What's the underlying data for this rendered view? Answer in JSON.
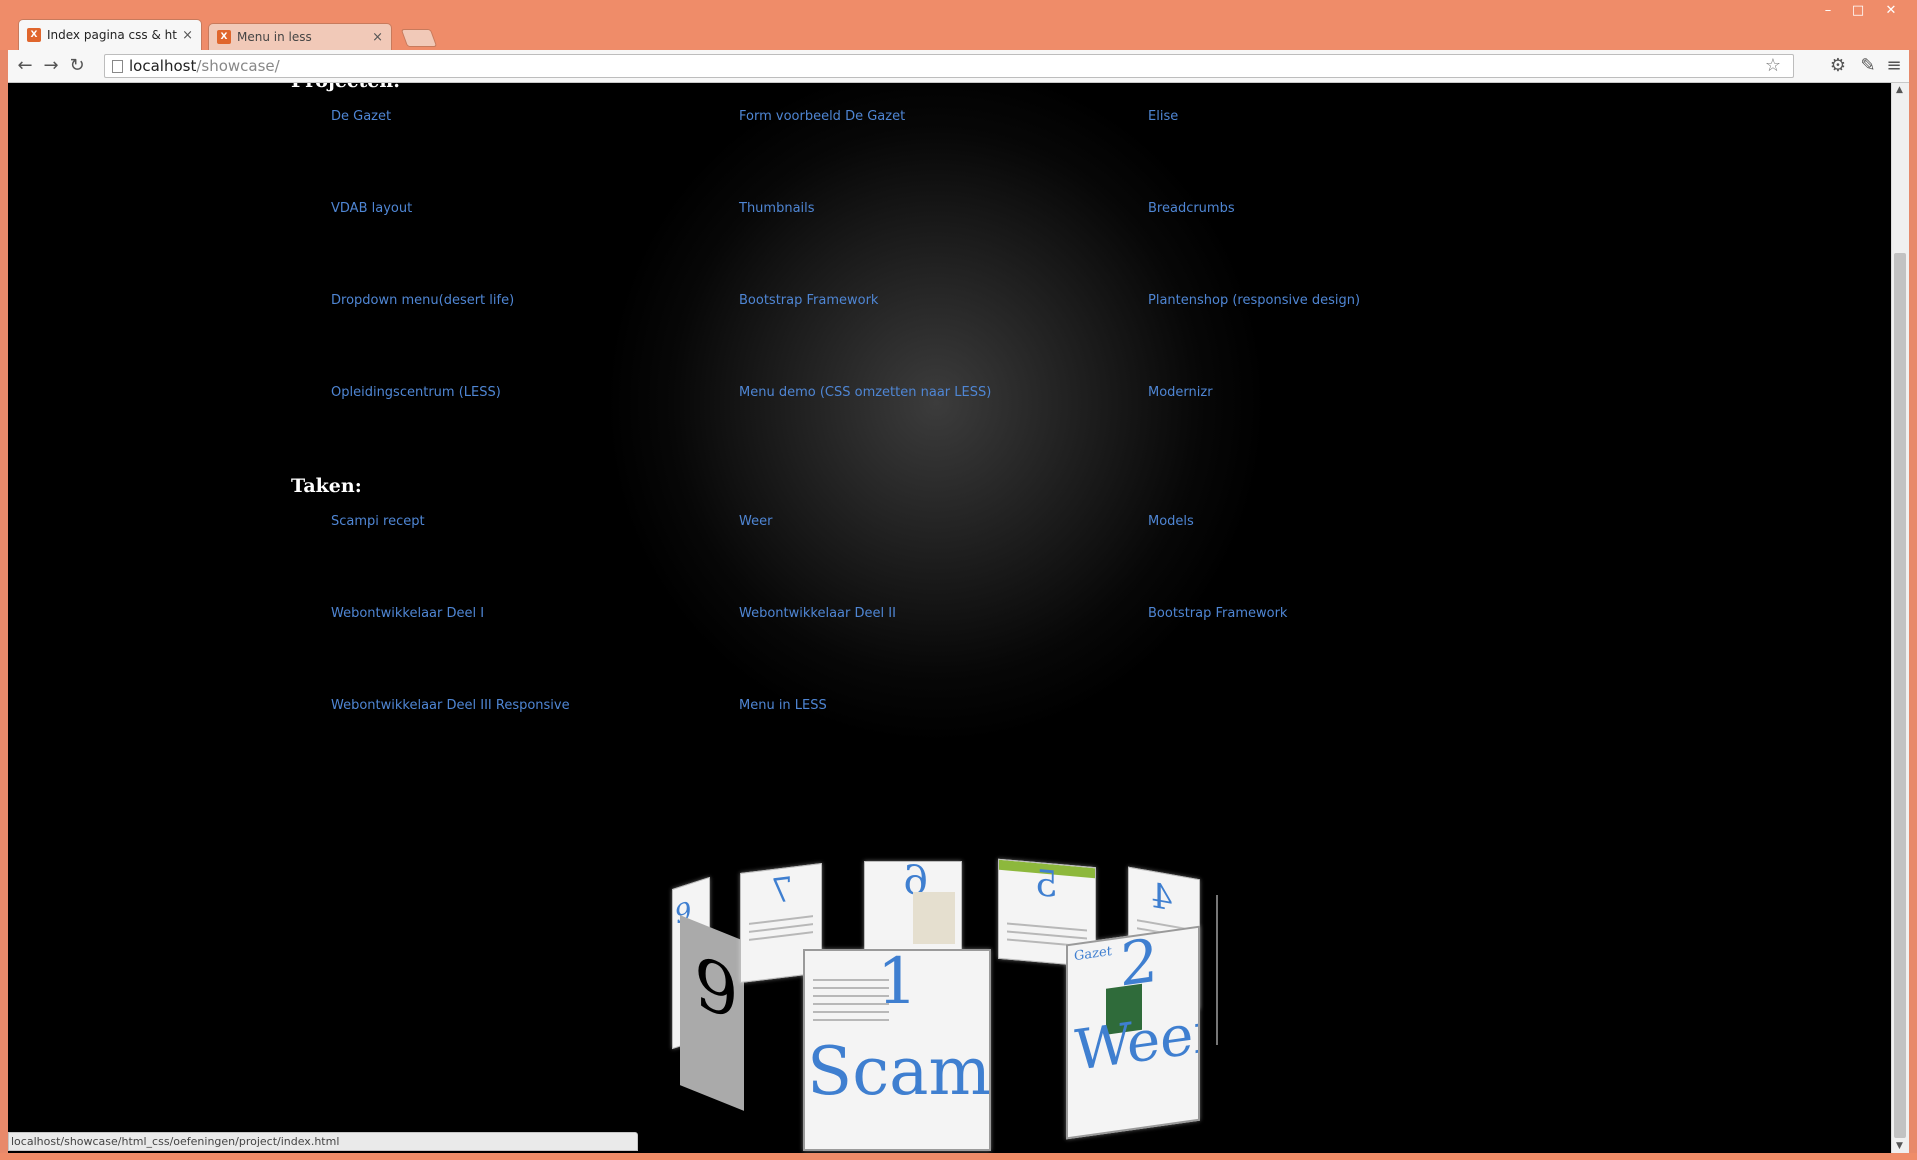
{
  "window": {
    "minimize_glyph": "–",
    "maximize_glyph": "□",
    "close_glyph": "✕"
  },
  "tabs": [
    {
      "title": "Index pagina css & html",
      "active": true
    },
    {
      "title": "Menu in less",
      "active": false
    }
  ],
  "address": {
    "host": "localhost",
    "path": "/showcase/"
  },
  "sections": {
    "projecten_title": "Projecten:",
    "taken_title": "Taken:"
  },
  "projecten": [
    "De Gazet",
    "Form voorbeeld De Gazet",
    "Elise",
    "VDAB layout",
    "Thumbnails",
    "Breadcrumbs",
    "Dropdown menu(desert life)",
    "Bootstrap Framework",
    "Plantenshop (responsive design)",
    "Opleidingscentrum (LESS)",
    "Menu demo (CSS omzetten naar LESS)",
    "Modernizr"
  ],
  "taken": [
    "Scampi recept",
    "Weer",
    "Models",
    "Webontwikkelaar Deel I",
    "Webontwikkelaar Deel II",
    "Bootstrap Framework",
    "Webontwikkelaar Deel III Responsive",
    "Menu in LESS"
  ],
  "carousel": {
    "cards": [
      {
        "num": "9"
      },
      {
        "num": "7"
      },
      {
        "num": "6"
      },
      {
        "num": "5"
      },
      {
        "num": "4"
      },
      {
        "num": "1",
        "label": "Scamp"
      },
      {
        "num": "2",
        "label": "Weer",
        "sub": "Gazet"
      }
    ]
  },
  "statusbar": {
    "url": "localhost/showcase/html_css/oefeningen/project/index.html"
  },
  "colors": {
    "chrome_frame": "#ef8c69",
    "link": "#4f86d4",
    "background": "#000000"
  }
}
